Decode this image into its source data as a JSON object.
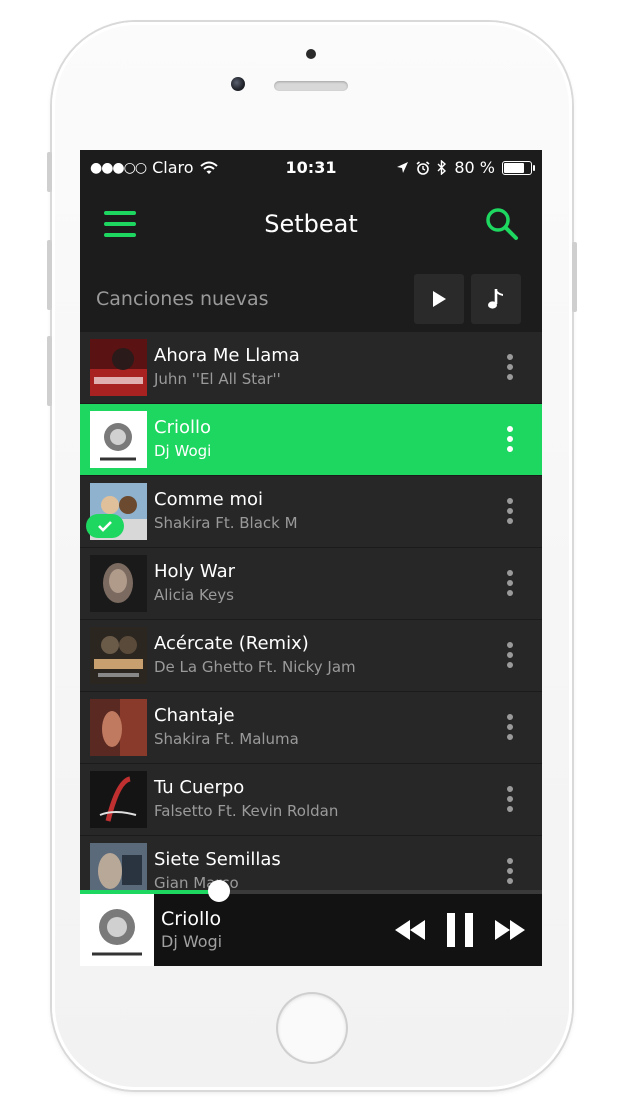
{
  "status_bar": {
    "signal": "●●●○○",
    "carrier": "Claro",
    "time": "10:31",
    "battery": "80 %",
    "battery_level_percent": 80
  },
  "app_bar": {
    "title": "Setbeat",
    "menu_icon": "hamburger-menu-icon",
    "search_icon": "search-icon"
  },
  "section": {
    "title": "Canciones nuevas",
    "play_all_icon": "play-icon",
    "music_icon": "music-note-icon"
  },
  "songs": [
    {
      "title": "Ahora Me Llama",
      "artist": "Juhn ''El All Star''",
      "active": false,
      "downloaded": false
    },
    {
      "title": "Criollo",
      "artist": "Dj Wogi",
      "active": true,
      "downloaded": false
    },
    {
      "title": "Comme moi",
      "artist": "Shakira  Ft. Black M",
      "active": false,
      "downloaded": true
    },
    {
      "title": "Holy War",
      "artist": "Alicia Keys",
      "active": false,
      "downloaded": false
    },
    {
      "title": "Acércate (Remix)",
      "artist": "De La Ghetto  Ft. Nicky Jam",
      "active": false,
      "downloaded": false
    },
    {
      "title": "Chantaje",
      "artist": "Shakira  Ft. Maluma",
      "active": false,
      "downloaded": false
    },
    {
      "title": "Tu Cuerpo",
      "artist": "Falsetto  Ft. Kevin Roldan",
      "active": false,
      "downloaded": false
    },
    {
      "title": "Siete Semillas",
      "artist": "Gian Marco",
      "active": false,
      "downloaded": false
    }
  ],
  "now_playing": {
    "title": "Criollo",
    "artist": "Dj Wogi",
    "progress_fraction": 0.3
  },
  "colors": {
    "accent": "#1ed760",
    "background": "#202020",
    "row": "#272727",
    "secondary_text": "#9a9a9a"
  }
}
